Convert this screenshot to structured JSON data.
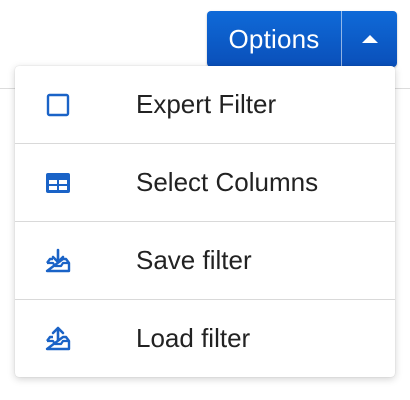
{
  "toolbar": {
    "options_label": "Options"
  },
  "menu": {
    "items": [
      {
        "label": "Expert Filter",
        "icon": "square-outline-icon"
      },
      {
        "label": "Select Columns",
        "icon": "table-columns-icon"
      },
      {
        "label": "Save filter",
        "icon": "tray-download-icon"
      },
      {
        "label": "Load filter",
        "icon": "tray-upload-icon"
      }
    ]
  },
  "colors": {
    "accent": "#0a5bd0",
    "icon": "#1a63c7",
    "text": "#222222"
  }
}
